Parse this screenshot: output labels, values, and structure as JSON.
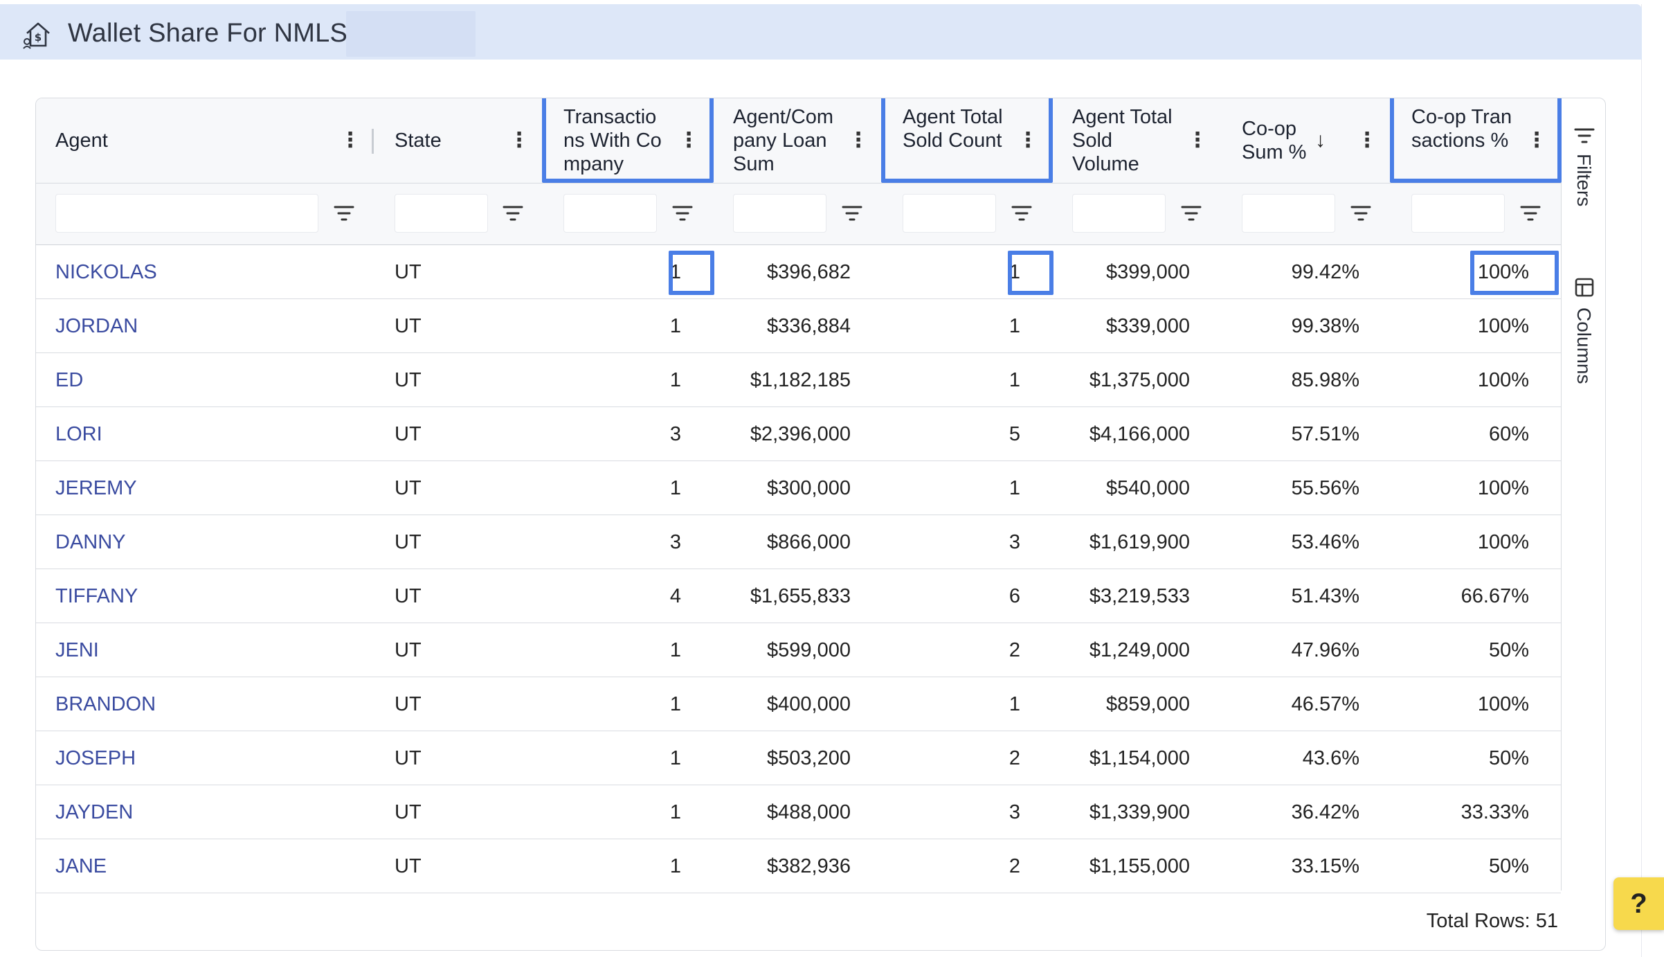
{
  "header": {
    "title": "Wallet Share For NMLS:",
    "icon": "house-money-icon",
    "bg_color": "#dde7f8"
  },
  "columns": [
    {
      "key": "agent",
      "label": "Agent"
    },
    {
      "key": "state",
      "label": "State"
    },
    {
      "key": "trans_with_company",
      "label": "Transactions With Company"
    },
    {
      "key": "loan_sum",
      "label": "Agent/Company Loan Sum"
    },
    {
      "key": "total_sold_count",
      "label": "Agent Total Sold Count"
    },
    {
      "key": "total_sold_volume",
      "label": "Agent Total Sold Volume"
    },
    {
      "key": "coop_sum_pct",
      "label": "Co-op Sum %"
    },
    {
      "key": "coop_trans_pct",
      "label": "Co-op Transactions %"
    }
  ],
  "sort": {
    "column": "Co-op Sum %",
    "direction": "descending"
  },
  "rows": [
    [
      "NICKOLAS",
      "UT",
      "1",
      "$396,682",
      "1",
      "$399,000",
      "99.42%",
      "100%"
    ],
    [
      "JORDAN",
      "UT",
      "1",
      "$336,884",
      "1",
      "$339,000",
      "99.38%",
      "100%"
    ],
    [
      "ED",
      "UT",
      "1",
      "$1,182,185",
      "1",
      "$1,375,000",
      "85.98%",
      "100%"
    ],
    [
      "LORI",
      "UT",
      "3",
      "$2,396,000",
      "5",
      "$4,166,000",
      "57.51%",
      "60%"
    ],
    [
      "JEREMY",
      "UT",
      "1",
      "$300,000",
      "1",
      "$540,000",
      "55.56%",
      "100%"
    ],
    [
      "DANNY",
      "UT",
      "3",
      "$866,000",
      "3",
      "$1,619,900",
      "53.46%",
      "100%"
    ],
    [
      "TIFFANY",
      "UT",
      "4",
      "$1,655,833",
      "6",
      "$3,219,533",
      "51.43%",
      "66.67%"
    ],
    [
      "JENI",
      "UT",
      "1",
      "$599,000",
      "2",
      "$1,249,000",
      "47.96%",
      "50%"
    ],
    [
      "BRANDON",
      "UT",
      "1",
      "$400,000",
      "1",
      "$859,000",
      "46.57%",
      "100%"
    ],
    [
      "JOSEPH",
      "UT",
      "1",
      "$503,200",
      "2",
      "$1,154,000",
      "43.6%",
      "50%"
    ],
    [
      "JAYDEN",
      "UT",
      "1",
      "$488,000",
      "3",
      "$1,339,900",
      "36.42%",
      "33.33%"
    ],
    [
      "JANE",
      "UT",
      "1",
      "$382,936",
      "2",
      "$1,155,000",
      "33.15%",
      "50%"
    ]
  ],
  "footer": {
    "total_rows": "Total Rows: 51"
  },
  "side_panel": {
    "filters_label": "Filters",
    "columns_label": "Columns"
  },
  "help": {
    "label": "?"
  },
  "colors": {
    "agent_link": "#3a4ba0",
    "highlight": "#4a7ee6",
    "help_bg": "#f7d94c"
  }
}
